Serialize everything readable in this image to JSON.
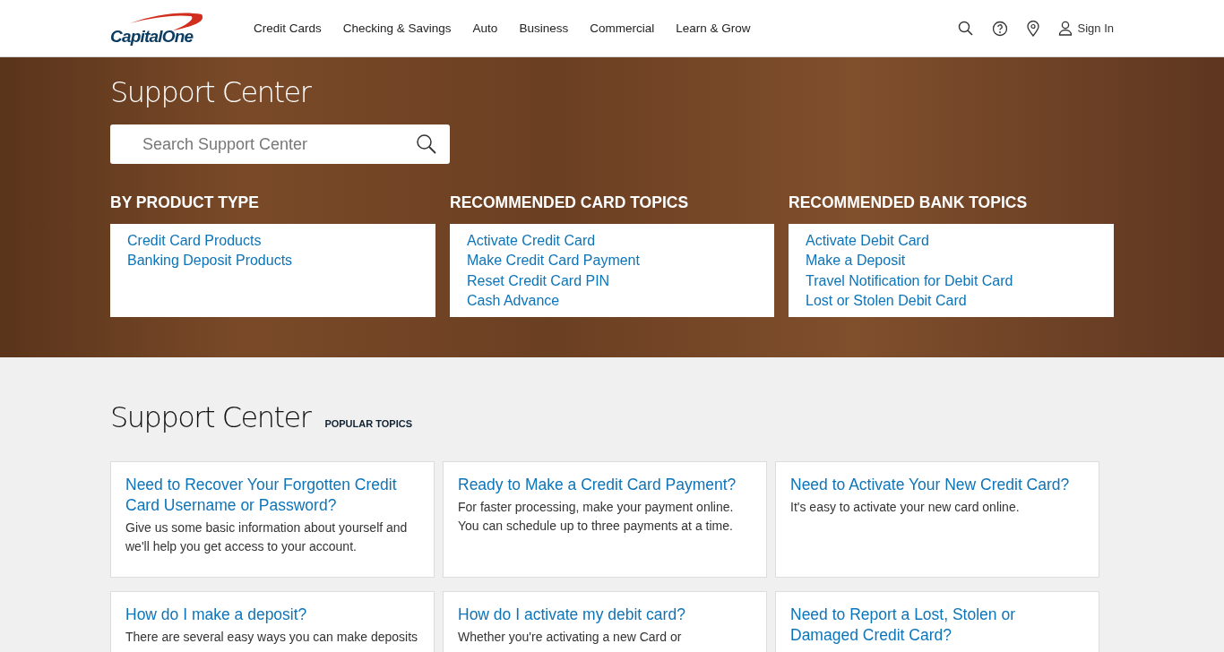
{
  "header": {
    "logo": "CapitalOne",
    "nav": [
      "Credit Cards",
      "Checking & Savings",
      "Auto",
      "Business",
      "Commercial",
      "Learn & Grow"
    ],
    "sign_in": "Sign In"
  },
  "hero": {
    "title": "Support Center",
    "search": {
      "placeholder": "Search Support Center"
    },
    "groups": [
      {
        "heading": "BY PRODUCT TYPE",
        "links": [
          "Credit Card Products",
          "Banking Deposit Products"
        ]
      },
      {
        "heading": "RECOMMENDED CARD TOPICS",
        "links": [
          "Activate Credit Card",
          "Make Credit Card Payment",
          "Reset Credit Card PIN",
          "Cash Advance"
        ]
      },
      {
        "heading": "RECOMMENDED BANK TOPICS",
        "links": [
          "Activate Debit Card",
          "Make a Deposit",
          "Travel Notification for Debit Card",
          "Lost or Stolen Debit Card"
        ]
      }
    ]
  },
  "popular": {
    "title": "Support Center",
    "subtitle": "POPULAR TOPICS",
    "cards": [
      {
        "title": "Need to Recover Your Forgotten Credit Card Username or Password?",
        "text": "Give us some basic information about yourself and we'll help you get access to your account."
      },
      {
        "title": "Ready to Make a Credit Card Payment?",
        "text": "For faster processing, make your payment online. You can schedule up to three payments at a time."
      },
      {
        "title": "Need to Activate Your New Credit Card?",
        "text": "It's easy to activate your new card online."
      },
      {
        "title": "How do I make a deposit?",
        "text": "There are several easy ways you can make deposits"
      },
      {
        "title": "How do I activate my debit card?",
        "text": "Whether you're activating a new Card or"
      },
      {
        "title": "Need to Report a Lost, Stolen or Damaged Credit Card?"
      }
    ]
  }
}
